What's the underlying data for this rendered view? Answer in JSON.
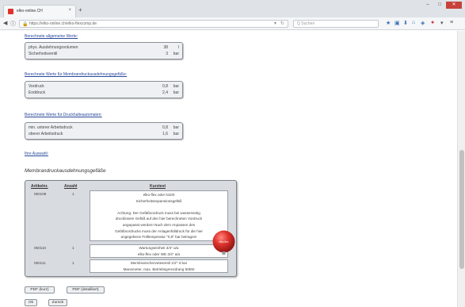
{
  "browser": {
    "tab_title": "elko-online.CH",
    "tab_close": "×",
    "new_tab": "+",
    "url": "https://elko-online.ch/elko-flexcomp.de",
    "search_placeholder": "Q Suchen",
    "win_min": "–",
    "win_max": "□",
    "win_close": "✕"
  },
  "sections": {
    "general_link": "Berechnete allgemeine Werte:",
    "general_rows": [
      {
        "label": "phys. Ausdehnungsvolumen",
        "value": "38",
        "unit": "l"
      },
      {
        "label": "Sicherheitsventil",
        "value": "3",
        "unit": "bar"
      }
    ],
    "membrane_link": "Berechnete Werte für Membrandruckausdehnungsgefäße:",
    "membrane_rows": [
      {
        "label": "Vordruck",
        "value": "0,8",
        "unit": "bar"
      },
      {
        "label": "Enddruck",
        "value": "2,4",
        "unit": "bar"
      }
    ],
    "pressure_link": "Berechnete Werte für Druckhalteautomaten:",
    "pressure_rows": [
      {
        "label": "min. unterer Arbeitsdruck",
        "value": "0,8",
        "unit": "bar"
      },
      {
        "label": "oberer Arbeitsdruck",
        "value": "1,6",
        "unit": "bar"
      }
    ],
    "selection_link": "Ihre Auswahl:",
    "product_title": "Membrandruckausdehnungsgefäße"
  },
  "products": {
    "headers": {
      "art": "Artikelnr.",
      "qty": "Anzahl",
      "desc": "Kurztext"
    },
    "rows": [
      {
        "art": "050108",
        "qty": "1",
        "lines": [
          "elko-flex oder N100",
          "Sicherheitsexpansionsgefäß",
          "",
          "Achtung: Der Gefäßvordruck muss bei wasserseitig",
          "drucklosem Gefäß auf den hier berechneten Vordruck",
          "angepasst werden! Nach dem Anpassen des",
          "Gefäßvordrucks muss der Anlagenfülldruck für die hier",
          "angegebene Fülltemperatur \"0,9\" bar betragen!"
        ]
      },
      {
        "art": "050110",
        "qty": "1",
        "lines": [
          "Wartungseinheit 3/4\" a/a",
          "elko-flex oder WE 3/4\" a/a"
        ]
      },
      {
        "art": "050111",
        "qty": "1",
        "lines": [
          "Membranschervetesentil 1/2\"-3 bar",
          "Manometer, max. Betriebsgrenzdrang 50kW"
        ]
      }
    ],
    "ball_label": "elko-flex"
  },
  "buttons": {
    "pdf_short": "PDF (kurz)",
    "pdf_detail": "PDF (detailliert)",
    "ok": "Ok",
    "back": "Zurück"
  },
  "colors": {
    "accent_link": "#2a4a9a",
    "ball": "#d42a2a"
  }
}
